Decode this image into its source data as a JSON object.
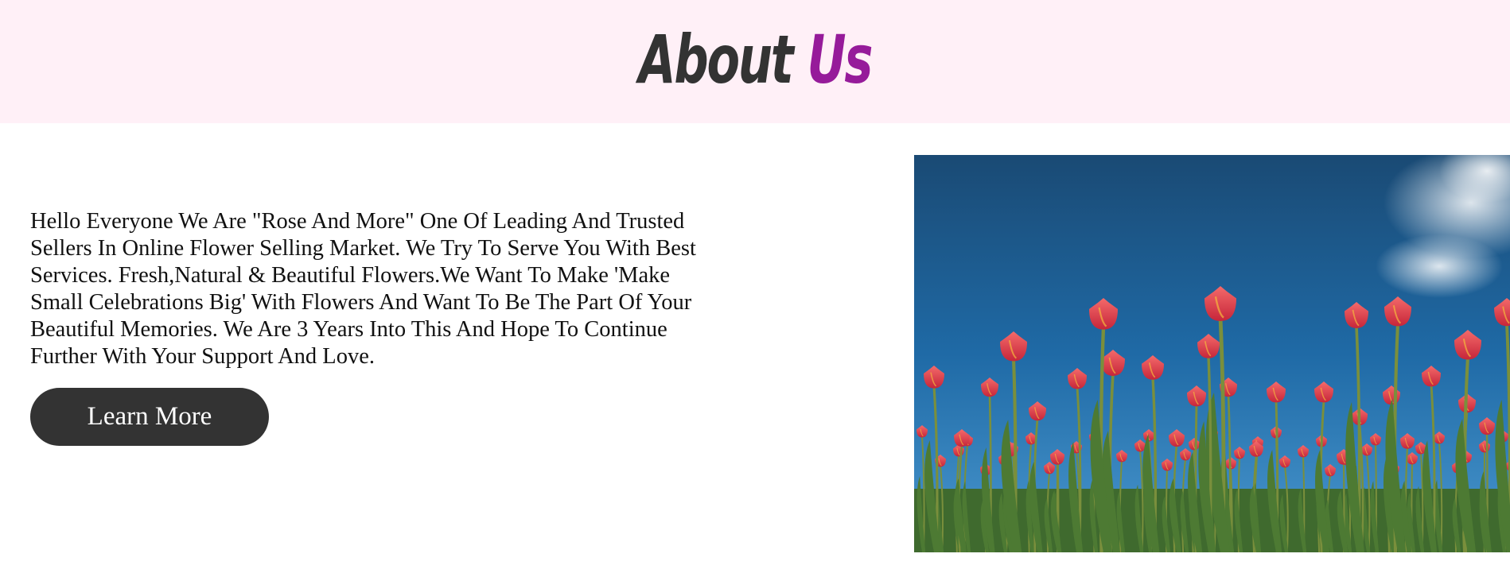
{
  "header": {
    "title_word1": "About",
    "title_word2": "Us"
  },
  "about": {
    "paragraph": "Hello Everyone We Are \"Rose And More\" One Of Leading And Trusted Sellers In Online Flower Selling Market. We Try To Serve You With Best Services. Fresh,Natural & Beautiful Flowers.We Want To Make 'Make Small Celebrations Big' With Flowers And Want To Be The Part Of Your Beautiful Memories. We Are 3 Years Into This And Hope To Continue Further With Your Support And Love.",
    "button_label": "Learn More"
  },
  "image": {
    "subject": "red tulips against blue sky"
  },
  "colors": {
    "header_bg": "#fff0f7",
    "title_dark": "#333333",
    "title_accent": "#961b9a",
    "button_bg": "#333333",
    "button_text": "#ffffff"
  }
}
